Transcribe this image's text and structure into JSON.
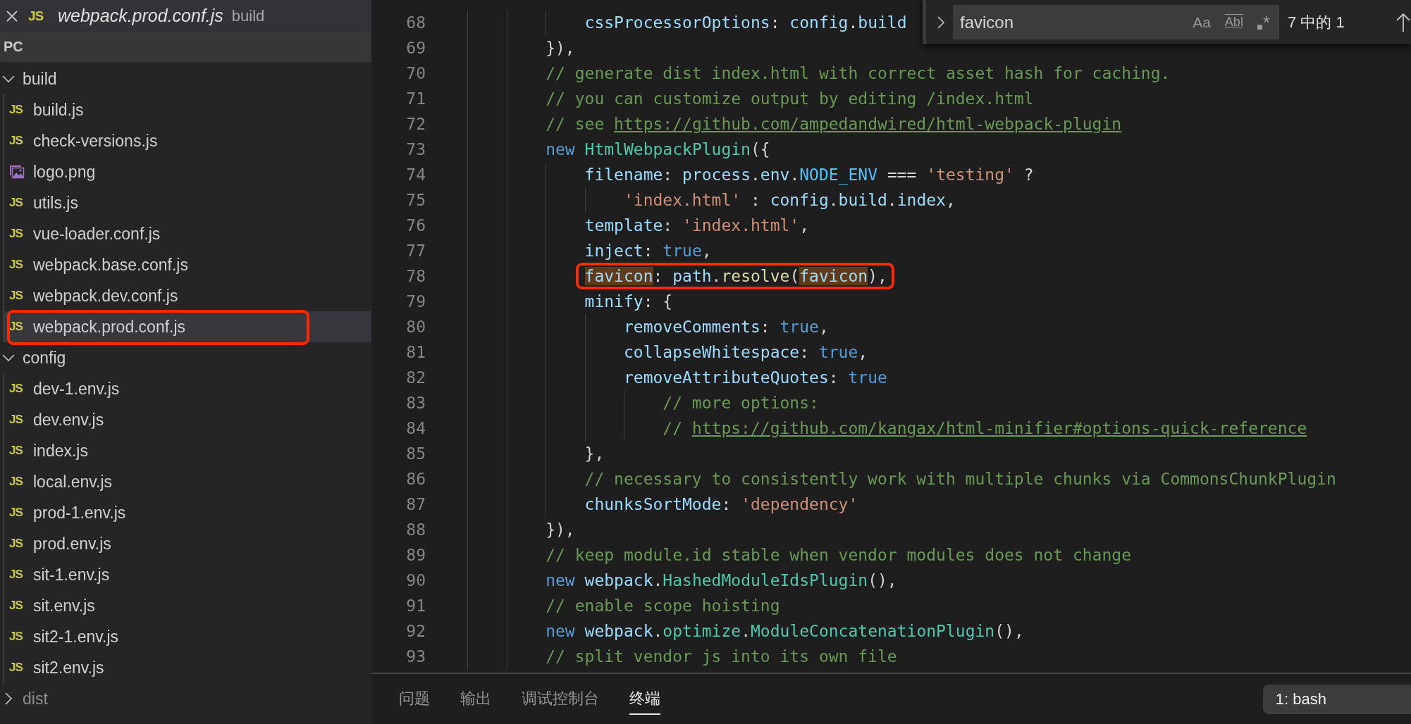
{
  "explorer": {
    "open_editor": {
      "badge": "JS",
      "filename": "webpack.prod.conf.js",
      "folder": "build"
    },
    "section": "PC",
    "tree": [
      {
        "kind": "folder",
        "name": "build",
        "expanded": true,
        "dimmed": false,
        "children": [
          {
            "kind": "js",
            "badge": "JS",
            "name": "build.js",
            "selected": false,
            "marked": false
          },
          {
            "kind": "js",
            "badge": "JS",
            "name": "check-versions.js",
            "selected": false,
            "marked": false
          },
          {
            "kind": "image",
            "name": "logo.png",
            "selected": false,
            "marked": false
          },
          {
            "kind": "js",
            "badge": "JS",
            "name": "utils.js",
            "selected": false,
            "marked": false
          },
          {
            "kind": "js",
            "badge": "JS",
            "name": "vue-loader.conf.js",
            "selected": false,
            "marked": false
          },
          {
            "kind": "js",
            "badge": "JS",
            "name": "webpack.base.conf.js",
            "selected": false,
            "marked": false
          },
          {
            "kind": "js",
            "badge": "JS",
            "name": "webpack.dev.conf.js",
            "selected": false,
            "marked": false
          },
          {
            "kind": "js",
            "badge": "JS",
            "name": "webpack.prod.conf.js",
            "selected": true,
            "marked": true
          }
        ]
      },
      {
        "kind": "folder",
        "name": "config",
        "expanded": true,
        "dimmed": false,
        "children": [
          {
            "kind": "js",
            "badge": "JS",
            "name": "dev-1.env.js",
            "selected": false,
            "marked": false
          },
          {
            "kind": "js",
            "badge": "JS",
            "name": "dev.env.js",
            "selected": false,
            "marked": false
          },
          {
            "kind": "js",
            "badge": "JS",
            "name": "index.js",
            "selected": false,
            "marked": false
          },
          {
            "kind": "js",
            "badge": "JS",
            "name": "local.env.js",
            "selected": false,
            "marked": false
          },
          {
            "kind": "js",
            "badge": "JS",
            "name": "prod-1.env.js",
            "selected": false,
            "marked": false
          },
          {
            "kind": "js",
            "badge": "JS",
            "name": "prod.env.js",
            "selected": false,
            "marked": false
          },
          {
            "kind": "js",
            "badge": "JS",
            "name": "sit-1.env.js",
            "selected": false,
            "marked": false
          },
          {
            "kind": "js",
            "badge": "JS",
            "name": "sit.env.js",
            "selected": false,
            "marked": false
          },
          {
            "kind": "js",
            "badge": "JS",
            "name": "sit2-1.env.js",
            "selected": false,
            "marked": false
          },
          {
            "kind": "js",
            "badge": "JS",
            "name": "sit2.env.js",
            "selected": false,
            "marked": false
          }
        ]
      },
      {
        "kind": "folder",
        "name": "dist",
        "expanded": false,
        "dimmed": true
      }
    ]
  },
  "editor": {
    "lines": [
      {
        "number": "68",
        "marked": false,
        "tokens": [
          {
            "text": "                cssProcessorOptions",
            "kind": "prop"
          },
          {
            "text": ": ",
            "kind": "pl"
          },
          {
            "text": "config",
            "kind": "prop"
          },
          {
            "text": ".",
            "kind": "pl"
          },
          {
            "text": "build",
            "kind": "prop"
          }
        ]
      },
      {
        "number": "69",
        "marked": false,
        "tokens": [
          {
            "text": "            }),",
            "kind": "pl"
          }
        ]
      },
      {
        "number": "70",
        "marked": false,
        "tokens": [
          {
            "text": "            // generate dist index.html with correct asset hash for caching.",
            "kind": "cm"
          }
        ]
      },
      {
        "number": "71",
        "marked": false,
        "tokens": [
          {
            "text": "            // you can customize output by editing /index.html",
            "kind": "cm"
          }
        ]
      },
      {
        "number": "72",
        "marked": false,
        "tokens": [
          {
            "text": "            // see ",
            "kind": "cm"
          },
          {
            "text": "https://github.com/ampedandwired/html-webpack-plugin",
            "kind": "link"
          }
        ]
      },
      {
        "number": "73",
        "marked": false,
        "tokens": [
          {
            "text": "            new",
            "kind": "kw"
          },
          {
            "text": " HtmlWebpackPlugin",
            "kind": "cls"
          },
          {
            "text": "({",
            "kind": "pl"
          }
        ]
      },
      {
        "number": "74",
        "marked": false,
        "tokens": [
          {
            "text": "                filename",
            "kind": "prop"
          },
          {
            "text": ": ",
            "kind": "pl"
          },
          {
            "text": "process",
            "kind": "prop"
          },
          {
            "text": ".",
            "kind": "pl"
          },
          {
            "text": "env",
            "kind": "prop"
          },
          {
            "text": ".",
            "kind": "pl"
          },
          {
            "text": "NODE_ENV",
            "kind": "const"
          },
          {
            "text": " === ",
            "kind": "pl"
          },
          {
            "text": "'testing'",
            "kind": "str"
          },
          {
            "text": " ?",
            "kind": "pl"
          }
        ]
      },
      {
        "number": "75",
        "marked": false,
        "tokens": [
          {
            "text": "                    'index.html'",
            "kind": "str"
          },
          {
            "text": " : ",
            "kind": "pl"
          },
          {
            "text": "config",
            "kind": "prop"
          },
          {
            "text": ".",
            "kind": "pl"
          },
          {
            "text": "build",
            "kind": "prop"
          },
          {
            "text": ".",
            "kind": "pl"
          },
          {
            "text": "index",
            "kind": "prop"
          },
          {
            "text": ",",
            "kind": "pl"
          }
        ]
      },
      {
        "number": "76",
        "marked": false,
        "tokens": [
          {
            "text": "                template",
            "kind": "prop"
          },
          {
            "text": ": ",
            "kind": "pl"
          },
          {
            "text": "'index.html'",
            "kind": "str"
          },
          {
            "text": ",",
            "kind": "pl"
          }
        ]
      },
      {
        "number": "77",
        "marked": false,
        "tokens": [
          {
            "text": "                inject",
            "kind": "prop"
          },
          {
            "text": ": ",
            "kind": "pl"
          },
          {
            "text": "true",
            "kind": "kw"
          },
          {
            "text": ",",
            "kind": "pl"
          }
        ]
      },
      {
        "number": "78",
        "marked": true,
        "tokens": [
          {
            "text": "                favicon",
            "kind": "match"
          },
          {
            "text": ": ",
            "kind": "pl"
          },
          {
            "text": "path",
            "kind": "prop"
          },
          {
            "text": ".",
            "kind": "pl"
          },
          {
            "text": "resolve",
            "kind": "fn"
          },
          {
            "text": "(",
            "kind": "pl"
          },
          {
            "text": "favicon",
            "kind": "match"
          },
          {
            "text": "),",
            "kind": "pl"
          }
        ]
      },
      {
        "number": "79",
        "marked": false,
        "tokens": [
          {
            "text": "                minify",
            "kind": "prop"
          },
          {
            "text": ": {",
            "kind": "pl"
          }
        ]
      },
      {
        "number": "80",
        "marked": false,
        "tokens": [
          {
            "text": "                    removeComments",
            "kind": "prop"
          },
          {
            "text": ": ",
            "kind": "pl"
          },
          {
            "text": "true",
            "kind": "kw"
          },
          {
            "text": ",",
            "kind": "pl"
          }
        ]
      },
      {
        "number": "81",
        "marked": false,
        "tokens": [
          {
            "text": "                    collapseWhitespace",
            "kind": "prop"
          },
          {
            "text": ": ",
            "kind": "pl"
          },
          {
            "text": "true",
            "kind": "kw"
          },
          {
            "text": ",",
            "kind": "pl"
          }
        ]
      },
      {
        "number": "82",
        "marked": false,
        "tokens": [
          {
            "text": "                    removeAttributeQuotes",
            "kind": "prop"
          },
          {
            "text": ": ",
            "kind": "pl"
          },
          {
            "text": "true",
            "kind": "kw"
          }
        ]
      },
      {
        "number": "83",
        "marked": false,
        "tokens": [
          {
            "text": "                        // more options:",
            "kind": "cm"
          }
        ]
      },
      {
        "number": "84",
        "marked": false,
        "tokens": [
          {
            "text": "                        // ",
            "kind": "cm"
          },
          {
            "text": "https://github.com/kangax/html-minifier#options-quick-reference",
            "kind": "link"
          }
        ]
      },
      {
        "number": "85",
        "marked": false,
        "tokens": [
          {
            "text": "                },",
            "kind": "pl"
          }
        ]
      },
      {
        "number": "86",
        "marked": false,
        "tokens": [
          {
            "text": "                // necessary to consistently work with multiple chunks via CommonsChunkPlugin",
            "kind": "cm"
          }
        ]
      },
      {
        "number": "87",
        "marked": false,
        "tokens": [
          {
            "text": "                chunksSortMode",
            "kind": "prop"
          },
          {
            "text": ": ",
            "kind": "pl"
          },
          {
            "text": "'dependency'",
            "kind": "str"
          }
        ]
      },
      {
        "number": "88",
        "marked": false,
        "tokens": [
          {
            "text": "            }),",
            "kind": "pl"
          }
        ]
      },
      {
        "number": "89",
        "marked": false,
        "tokens": [
          {
            "text": "            // keep module.id stable when vendor modules does not change",
            "kind": "cm"
          }
        ]
      },
      {
        "number": "90",
        "marked": false,
        "tokens": [
          {
            "text": "            new",
            "kind": "kw"
          },
          {
            "text": " webpack",
            "kind": "prop"
          },
          {
            "text": ".",
            "kind": "pl"
          },
          {
            "text": "HashedModuleIdsPlugin",
            "kind": "cls"
          },
          {
            "text": "(),",
            "kind": "pl"
          }
        ]
      },
      {
        "number": "91",
        "marked": false,
        "tokens": [
          {
            "text": "            // enable scope hoisting",
            "kind": "cm"
          }
        ]
      },
      {
        "number": "92",
        "marked": false,
        "tokens": [
          {
            "text": "            new",
            "kind": "kw"
          },
          {
            "text": " webpack",
            "kind": "prop"
          },
          {
            "text": ".",
            "kind": "pl"
          },
          {
            "text": "optimize",
            "kind": "cls"
          },
          {
            "text": ".",
            "kind": "pl"
          },
          {
            "text": "ModuleConcatenationPlugin",
            "kind": "cls"
          },
          {
            "text": "(),",
            "kind": "pl"
          }
        ]
      },
      {
        "number": "93",
        "marked": false,
        "tokens": [
          {
            "text": "            // split vendor js into its own file",
            "kind": "cm"
          }
        ]
      }
    ]
  },
  "find": {
    "value": "favicon",
    "options": [
      {
        "kind": "case",
        "label": "Aa",
        "on": false
      },
      {
        "kind": "word",
        "label": "Abl",
        "on": false
      },
      {
        "kind": "regex",
        "label": "*",
        "on": false
      }
    ],
    "result": "7 中的 1"
  },
  "panel": {
    "tabs": [
      {
        "label": "问题",
        "selected": false
      },
      {
        "label": "输出",
        "selected": false
      },
      {
        "label": "调试控制台",
        "selected": false
      },
      {
        "label": "终端",
        "selected": true
      }
    ],
    "terminal": "1: bash"
  }
}
